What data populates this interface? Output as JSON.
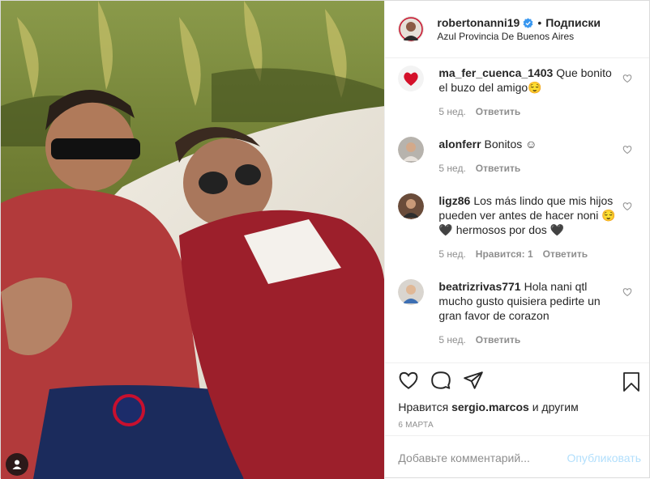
{
  "header": {
    "username": "robertonanni19",
    "dot": "•",
    "follow_label": "Подписки",
    "location": "Azul Provincia De Buenos Aires"
  },
  "comments": [
    {
      "user": "ma_fer_cuenca_1403",
      "text": "Que bonito el buzo del amigo😌",
      "time": "5 нед.",
      "reply_label": "Ответить"
    },
    {
      "user": "alonferr",
      "text": "Bonitos ☺",
      "time": "5 нед.",
      "reply_label": "Ответить"
    },
    {
      "user": "ligz86",
      "text": "Los más lindo que mis hijos pueden ver antes de hacer noni 😌🖤 hermosos por dos 🖤",
      "time": "5 нед.",
      "likes_label": "Нравится: 1",
      "reply_label": "Ответить"
    },
    {
      "user": "beatrizrivas771",
      "text": "Hola nani qtl mucho gusto quisiera pedirte un gran favor de corazon",
      "time": "5 нед.",
      "reply_label": "Ответить"
    }
  ],
  "likes": {
    "prefix": "Нравится",
    "user": "sergio.marcos",
    "suffix": "и другим"
  },
  "date": "6 марта",
  "add_comment": {
    "placeholder": "Добавьте комментарий...",
    "publish_label": "Опубликовать"
  },
  "icons": {
    "like": "heart-icon",
    "comment": "comment-icon",
    "share": "share-icon",
    "save": "bookmark-icon",
    "verified": "verified-badge-icon",
    "tag": "user-tag-icon"
  },
  "colors": {
    "verified": "#3897f0",
    "publish_disabled": "#b2dffc",
    "muted": "#8e8e8e"
  }
}
